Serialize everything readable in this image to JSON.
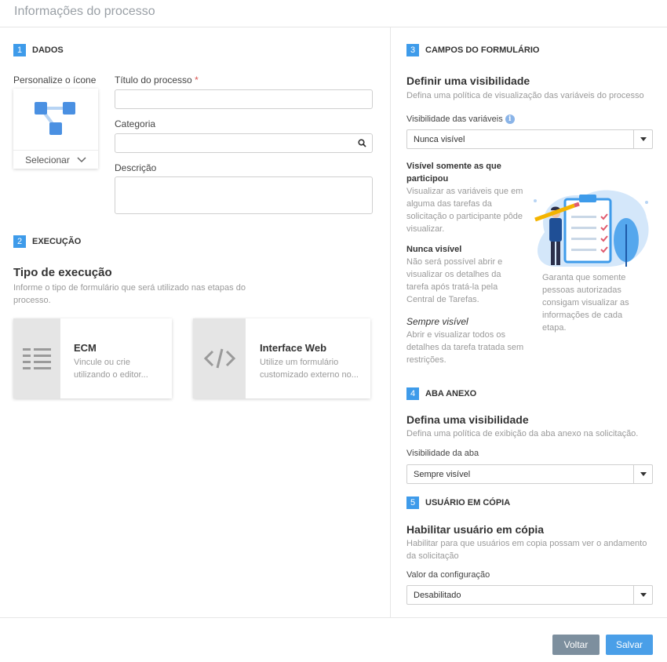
{
  "header": {
    "title": "Informações do processo"
  },
  "section1": {
    "number": "1",
    "title": "DADOS",
    "icon_label": "Personalize o ícone",
    "icon_select_label": "Selecionar",
    "title_label": "Título do processo",
    "required_mark": "*",
    "category_label": "Categoria",
    "description_label": "Descrição"
  },
  "section2": {
    "number": "2",
    "title": "EXECUÇÃO",
    "heading": "Tipo de execução",
    "description": "Informe o tipo de formulário que será utilizado nas etapas do processo.",
    "cards": [
      {
        "title": "ECM",
        "description": "Vincule ou crie utilizando o editor..."
      },
      {
        "title": "Interface Web",
        "description": "Utilize um formulário customizado externo no..."
      }
    ]
  },
  "section3": {
    "number": "3",
    "title": "CAMPOS DO FORMULÁRIO",
    "heading": "Definir uma visibilidade",
    "description": "Defina uma política de visualização das variáveis do processo",
    "select_label": "Visibilidade das variáveis",
    "select_value": "Nunca visível",
    "options": [
      {
        "title": "Visível somente as que participou",
        "description": "Visualizar as variáveis que em alguma das tarefas da solicitação o participante pôde visualizar."
      },
      {
        "title": "Nunca visível",
        "description": "Não será possível abrir e visualizar os detalhes da tarefa após tratá-la pela Central de Tarefas."
      },
      {
        "title": "Sempre visível",
        "description": "Abrir e visualizar todos os detalhes da tarefa tratada sem restrições."
      }
    ],
    "illustration_caption": "Garanta que somente pessoas autorizadas consigam visualizar as informações de cada etapa."
  },
  "section4": {
    "number": "4",
    "title": "ABA ANEXO",
    "heading": "Defina uma visibilidade",
    "description": "Defina uma política de exibição da aba anexo na solicitação.",
    "select_label": "Visibilidade da aba",
    "select_value": "Sempre visível"
  },
  "section5": {
    "number": "5",
    "title": "USUÁRIO EM CÓPIA",
    "heading": "Habilitar usuário em cópia",
    "description": "Habilitar para que usuários em copia possam ver o andamento da solicitação",
    "select_label": "Valor da configuração",
    "select_value": "Desabilitado"
  },
  "footer": {
    "back_label": "Voltar",
    "save_label": "Salvar"
  },
  "colors": {
    "accent": "#3e9bea",
    "save": "#4a9fe8",
    "back": "#7d8f9e",
    "icon_blue": "#4a90e2"
  }
}
